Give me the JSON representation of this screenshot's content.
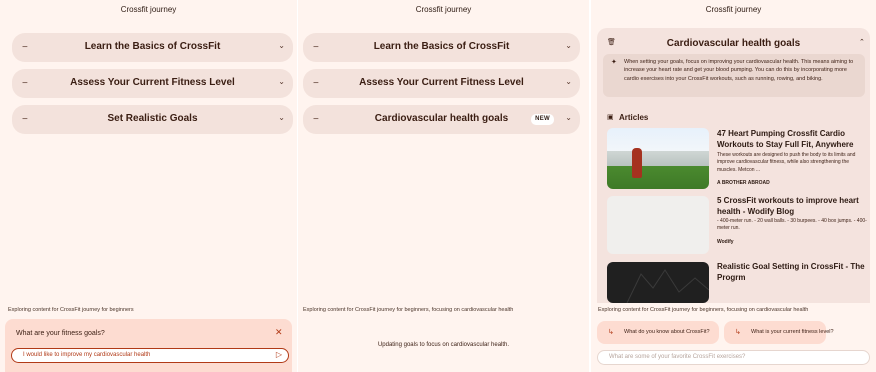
{
  "app_title": "Crossfit journey",
  "panel1": {
    "accordions": [
      {
        "label": "Learn the Basics of CrossFit"
      },
      {
        "label": "Assess Your Current Fitness Level"
      },
      {
        "label": "Set Realistic Goals"
      }
    ],
    "status": "Exploring content for CrossFit journey for beginners",
    "question": "What are your fitness goals?",
    "input_value": "I would like to improve my cardiovascular health"
  },
  "panel2": {
    "accordions": [
      {
        "label": "Learn the Basics of CrossFit"
      },
      {
        "label": "Assess Your Current Fitness Level"
      },
      {
        "label": "Cardiovascular health goals",
        "badge": "NEW"
      }
    ],
    "status": "Exploring content for CrossFit journey for beginners, focusing on cardiovascular health",
    "updating": "Updating goals to focus on cardiovascular health."
  },
  "panel3": {
    "card_title": "Cardiovascular health goals",
    "summary": "When setting your goals, focus on improving your cardiovascular health. This means aiming to increase your heart rate and get your blood pumping. You can do this by incorporating more cardio exercises into your CrossFit workouts, such as running, rowing, and biking.",
    "articles_heading": "Articles",
    "articles": [
      {
        "title": "47 Heart Pumping Crossfit Cardio Workouts to Stay Full Fit, Anywhere",
        "desc": "These workouts are designed to push the body to its limits and improve cardiovascular fitness, while also strengthening the muscles. Metcon ...",
        "source": "A BROTHER ABROAD"
      },
      {
        "title": "5 CrossFit workouts to improve heart health - Wodify Blog",
        "desc": "- 400-meter run. - 20 wall balls. - 30 burpees. - 40 box jumps. - 400-meter run.",
        "source": "Wodify"
      },
      {
        "title": "Realistic Goal Setting in CrossFit - The Progrm"
      }
    ],
    "status": "Exploring content for CrossFit journey for beginners, focusing on cardiovascular health",
    "suggestions": [
      {
        "label": "What do you know about CrossFit?"
      },
      {
        "label": "What is your current fitness level?"
      }
    ],
    "input_placeholder": "What are some of your favorite CrossFit exercises?"
  },
  "icons": {
    "collapse": "minus-icon",
    "expand": "chevron-down-icon",
    "collapse_up": "chevron-up-icon",
    "close": "close-icon",
    "send": "send-icon",
    "sparkle": "sparkle-icon",
    "articles": "articles-icon",
    "suggestion": "reply-arrow-icon",
    "card": "trash-icon"
  },
  "colors": {
    "background": "#fff4ef",
    "accordion": "#f3e2dc",
    "accent": "#b13a17",
    "input_card": "#fddcd1"
  }
}
